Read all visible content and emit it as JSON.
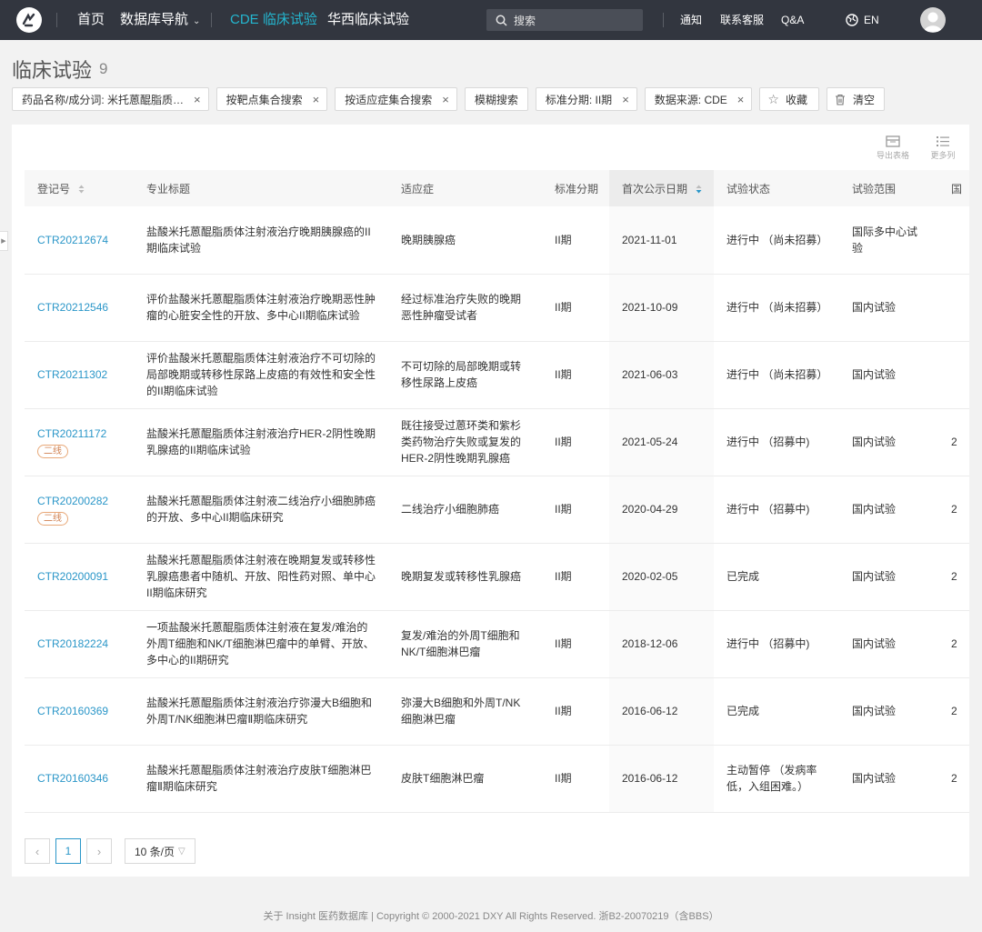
{
  "nav": {
    "home": "首页",
    "db_nav": "数据库导航",
    "cde": "CDE 临床试验",
    "huaxi": "华西临床试验",
    "search_placeholder": "搜索",
    "notice": "通知",
    "contact": "联系客服",
    "qa": "Q&A",
    "lang": "EN"
  },
  "page": {
    "title": "临床试验",
    "count": "9"
  },
  "filters": [
    {
      "label": "药品名称/成分词: 米托蒽醌脂质…"
    },
    {
      "label": "按靶点集合搜索"
    },
    {
      "label": "按适应症集合搜索"
    },
    {
      "label": "模糊搜索"
    },
    {
      "label": "标准分期: II期"
    },
    {
      "label": "数据来源: CDE"
    }
  ],
  "actions": {
    "favorite": "收藏",
    "clear": "清空"
  },
  "toolbar": {
    "export": "导出表格",
    "more_cols": "更多列"
  },
  "table": {
    "headers": {
      "reg_no": "登记号",
      "title": "专业标题",
      "indication": "适应症",
      "phase": "标准分期",
      "date": "首次公示日期",
      "status": "试验状态",
      "scope": "试验范围",
      "extra": "国"
    },
    "rows": [
      {
        "reg_no": "CTR20212674",
        "tag": "",
        "title": "盐酸米托蒽醌脂质体注射液治疗晚期胰腺癌的II期临床试验",
        "indication": "晚期胰腺癌",
        "phase": "II期",
        "date": "2021-11-01",
        "status": "进行中 （尚未招募）",
        "scope": "国际多中心试验",
        "extra": ""
      },
      {
        "reg_no": "CTR20212546",
        "tag": "",
        "title": "评价盐酸米托蒽醌脂质体注射液治疗晚期恶性肿瘤的心脏安全性的开放、多中心II期临床试验",
        "indication": "经过标准治疗失败的晚期恶性肿瘤受试者",
        "phase": "II期",
        "date": "2021-10-09",
        "status": "进行中 （尚未招募）",
        "scope": "国内试验",
        "extra": ""
      },
      {
        "reg_no": "CTR20211302",
        "tag": "",
        "title": "评价盐酸米托蒽醌脂质体注射液治疗不可切除的局部晚期或转移性尿路上皮癌的有效性和安全性的II期临床试验",
        "indication": "不可切除的局部晚期或转移性尿路上皮癌",
        "phase": "II期",
        "date": "2021-06-03",
        "status": "进行中 （尚未招募）",
        "scope": "国内试验",
        "extra": ""
      },
      {
        "reg_no": "CTR20211172",
        "tag": "二线",
        "title": "盐酸米托蒽醌脂质体注射液治疗HER-2阴性晚期乳腺癌的II期临床试验",
        "indication": "既往接受过蒽环类和紫杉类药物治疗失败或复发的HER-2阴性晚期乳腺癌",
        "phase": "II期",
        "date": "2021-05-24",
        "status": "进行中 （招募中)",
        "scope": "国内试验",
        "extra": "2"
      },
      {
        "reg_no": "CTR20200282",
        "tag": "二线",
        "title": "盐酸米托蒽醌脂质体注射液二线治疗小细胞肺癌的开放、多中心II期临床研究",
        "indication": "二线治疗小细胞肺癌",
        "phase": "II期",
        "date": "2020-04-29",
        "status": "进行中 （招募中)",
        "scope": "国内试验",
        "extra": "2"
      },
      {
        "reg_no": "CTR20200091",
        "tag": "",
        "title": "盐酸米托蒽醌脂质体注射液在晚期复发或转移性乳腺癌患者中随机、开放、阳性药对照、单中心II期临床研究",
        "indication": "晚期复发或转移性乳腺癌",
        "phase": "II期",
        "date": "2020-02-05",
        "status": "已完成",
        "scope": "国内试验",
        "extra": "2"
      },
      {
        "reg_no": "CTR20182224",
        "tag": "",
        "title": "一项盐酸米托蒽醌脂质体注射液在复发/难治的外周T细胞和NK/T细胞淋巴瘤中的单臂、开放、多中心的II期研究",
        "indication": "复发/难治的外周T细胞和NK/T细胞淋巴瘤",
        "phase": "II期",
        "date": "2018-12-06",
        "status": "进行中 （招募中)",
        "scope": "国内试验",
        "extra": "2"
      },
      {
        "reg_no": "CTR20160369",
        "tag": "",
        "title": "盐酸米托蒽醌脂质体注射液治疗弥漫大B细胞和外周T/NK细胞淋巴瘤Ⅱ期临床研究",
        "indication": "弥漫大B细胞和外周T/NK细胞淋巴瘤",
        "phase": "II期",
        "date": "2016-06-12",
        "status": "已完成",
        "scope": "国内试验",
        "extra": "2"
      },
      {
        "reg_no": "CTR20160346",
        "tag": "",
        "title": "盐酸米托蒽醌脂质体注射液治疗皮肤T细胞淋巴瘤Ⅱ期临床研究",
        "indication": "皮肤T细胞淋巴瘤",
        "phase": "II期",
        "date": "2016-06-12",
        "status": "主动暂停 （发病率低，入组困难。）",
        "scope": "国内试验",
        "extra": "2"
      }
    ]
  },
  "pagination": {
    "current": "1",
    "page_size": "10 条/页"
  },
  "footer": "关于 Insight 医药数据库  |  Copyright © 2000-2021 DXY All Rights Reserved. 浙B2-20070219（含BBS）"
}
